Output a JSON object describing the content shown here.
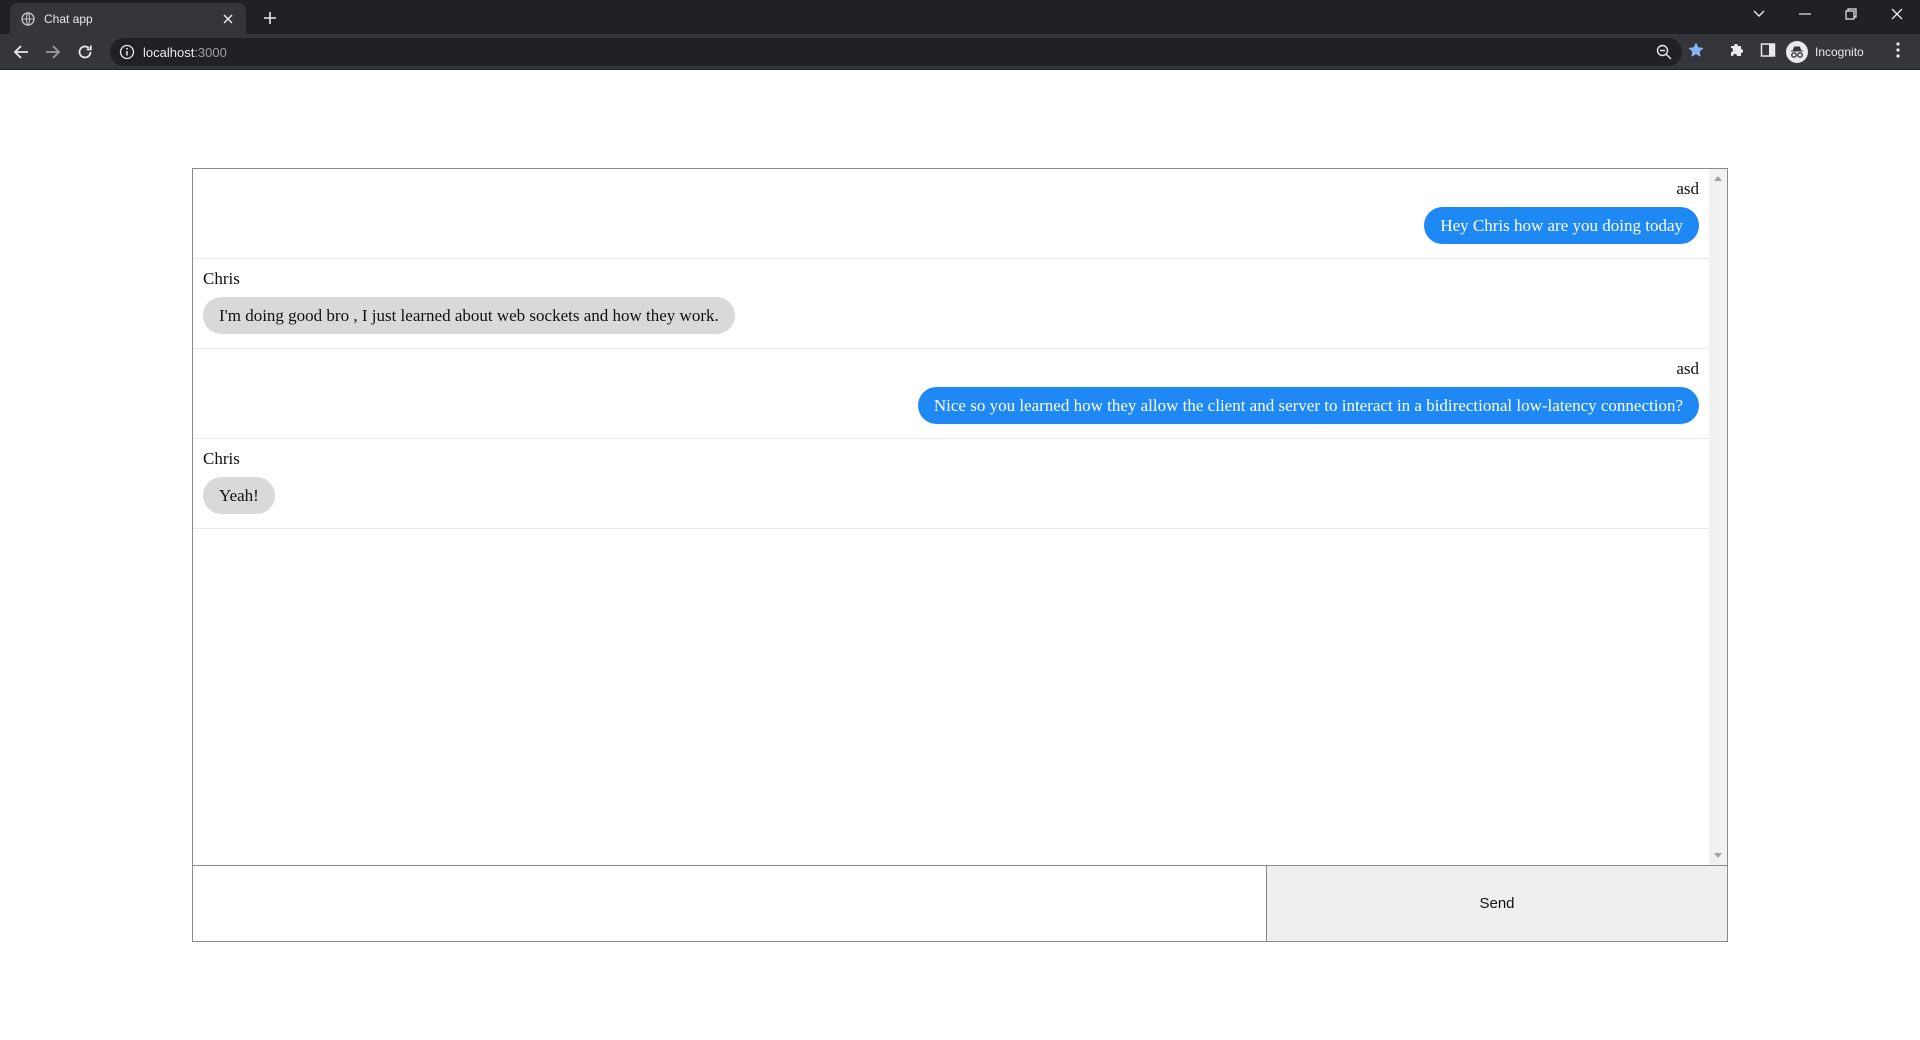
{
  "browser": {
    "tab_title": "Chat app",
    "url_host": "localhost",
    "url_port": ":3000",
    "profile_label": "Incognito"
  },
  "chat": {
    "messages": [
      {
        "sender": "asd",
        "text": "Hey Chris how are you doing today",
        "side": "right"
      },
      {
        "sender": "Chris",
        "text": "I'm doing good bro , I just learned about web sockets and how they work.",
        "side": "left"
      },
      {
        "sender": "asd",
        "text": "Nice so you learned how they allow the client and server to interact in a bidirectional low-latency connection?",
        "side": "right"
      },
      {
        "sender": "Chris",
        "text": "Yeah!",
        "side": "left"
      }
    ],
    "input_value": "",
    "send_label": "Send"
  },
  "colors": {
    "own_bubble": "#1e88f5",
    "other_bubble": "#d9d9d9"
  }
}
